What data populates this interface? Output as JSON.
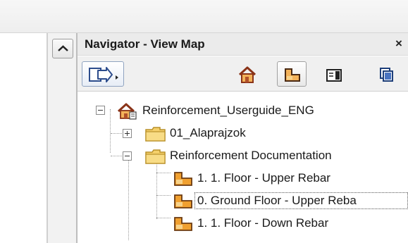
{
  "panel": {
    "title": "Navigator - View Map",
    "close_label": "×"
  },
  "toolbar": {
    "buttons": [
      {
        "name": "navigator-popup-icon",
        "selected": true
      },
      {
        "name": "project-map-icon",
        "selected": false
      },
      {
        "name": "view-map-icon",
        "selected": true
      },
      {
        "name": "layout-book-icon",
        "selected": false
      },
      {
        "name": "publisher-sets-icon",
        "selected": false
      }
    ]
  },
  "tree": {
    "root": {
      "label": "Reinforcement_Userguide_ENG",
      "icon": "project-house-icon",
      "expanded": true
    },
    "folders": [
      {
        "label": "01_Alaprajzok",
        "icon": "folder-icon",
        "expanded": false
      },
      {
        "label": "Reinforcement Documentation",
        "icon": "folder-icon",
        "expanded": true
      }
    ],
    "views": [
      {
        "label": "1. 1. Floor - Upper Rebar",
        "icon": "floor-plan-view-icon",
        "selected": false
      },
      {
        "label": "0. Ground Floor - Upper Reba",
        "icon": "floor-plan-view-icon",
        "selected": true
      },
      {
        "label": "1. 1. Floor - Down Rebar",
        "icon": "floor-plan-view-icon",
        "selected": false
      }
    ]
  },
  "colors": {
    "folder": "#f5d06a",
    "house_roof": "#b0502a",
    "view_icon_orange": "#f0a030",
    "selection_blue": "#8fa3c0"
  }
}
